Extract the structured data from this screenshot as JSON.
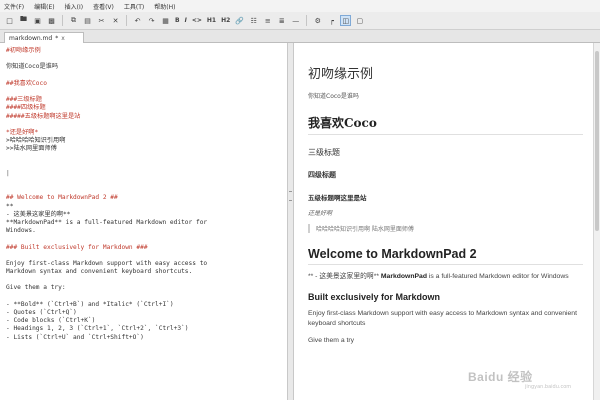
{
  "menu": [
    "文件(F)",
    "编辑(E)",
    "插入(I)",
    "查看(V)",
    "工具(T)",
    "帮助(H)"
  ],
  "toolbar": {
    "icons": [
      "new-file-icon",
      "open-folder-icon",
      "save-icon",
      "save-all-icon",
      "copy-icon",
      "paste-icon",
      "cut-icon",
      "delete-icon",
      "undo-icon",
      "redo-icon",
      "image-icon",
      "bold-text",
      "italic-text",
      "code-text",
      "h1-text",
      "h2-text",
      "hyperlink-icon",
      "date-icon",
      "unordered-list-icon",
      "ordered-list-icon",
      "horizontal-rule-icon",
      "settings-icon",
      "sidebar-icon",
      "live-preview-icon",
      "fullscreen-icon"
    ],
    "labels": {
      "bold": "B",
      "italic": "I",
      "code": "<>",
      "h1": "H1",
      "h2": "H2"
    }
  },
  "tab": {
    "label": "markdown.md",
    "modified": "*",
    "close": "x"
  },
  "editor": {
    "lines": [
      {
        "text": "#初吻缘示例",
        "style": "red"
      },
      {
        "text": "",
        "style": "dark"
      },
      {
        "text": "你知道Coco是谁吗",
        "style": "dark"
      },
      {
        "text": "",
        "style": "dark"
      },
      {
        "text": "##我喜欢Coco",
        "style": "red"
      },
      {
        "text": "",
        "style": "dark"
      },
      {
        "text": "###三级标题",
        "style": "red"
      },
      {
        "text": "####四级标题",
        "style": "red"
      },
      {
        "text": "#####五级标题啊这里是站",
        "style": "red"
      },
      {
        "text": "",
        "style": "dark"
      },
      {
        "text": "*还是好啊*",
        "style": "red"
      },
      {
        "text": ">哈哈哈哈知识引用啊",
        "style": "dark"
      },
      {
        "text": ">>陆水网里面师傅",
        "style": "dark"
      },
      {
        "text": "",
        "style": "dark"
      },
      {
        "text": "",
        "style": "dark"
      },
      {
        "text": "|",
        "style": "cursor"
      },
      {
        "text": "",
        "style": "dark"
      },
      {
        "text": "",
        "style": "dark"
      },
      {
        "text": "## Welcome to MarkdownPad 2 ##",
        "style": "red"
      },
      {
        "text": "**",
        "style": "dark"
      },
      {
        "text": "- 这美景这家里的啊**",
        "style": "dark"
      },
      {
        "text": "**MarkdownPad** is a full-featured Markdown editor for",
        "style": "dark"
      },
      {
        "text": "Windows.",
        "style": "dark"
      },
      {
        "text": "",
        "style": "dark"
      },
      {
        "text": "### Built exclusively for Markdown ###",
        "style": "red"
      },
      {
        "text": "",
        "style": "dark"
      },
      {
        "text": "Enjoy first-class Markdown support with easy access to",
        "style": "dark"
      },
      {
        "text": "Markdown syntax and convenient keyboard shortcuts.",
        "style": "dark"
      },
      {
        "text": "",
        "style": "dark"
      },
      {
        "text": "Give them a try:",
        "style": "dark"
      },
      {
        "text": "",
        "style": "dark"
      },
      {
        "text": "- **Bold** (`Ctrl+B`) and *Italic* (`Ctrl+I`)",
        "style": "dark"
      },
      {
        "text": "- Quotes (`Ctrl+Q`)",
        "style": "dark"
      },
      {
        "text": "- Code blocks (`Ctrl+K`)",
        "style": "dark"
      },
      {
        "text": "- Headings 1, 2, 3 (`Ctrl+1`, `Ctrl+2`, `Ctrl+3`)",
        "style": "dark"
      },
      {
        "text": "- Lists (`Ctrl+U` and `Ctrl+Shift+O`)",
        "style": "dark"
      }
    ]
  },
  "preview": {
    "h1": "初吻缘示例",
    "p1": "你知道Coco是谁吗",
    "h2": "我喜欢Coco",
    "h3": "三级标题",
    "h4": "四级标题",
    "h5": "五级标题啊这里是站",
    "italic": "还是好啊",
    "quote": "哈哈哈哈知识引用啊 陆水网里面师傅",
    "welcome": "Welcome to MarkdownPad 2",
    "intro_prefix": "** - 这美景这家里的啊** ",
    "intro_bold": "MarkdownPad",
    "intro_rest": " is a full-featured Markdown editor for Windows",
    "built": "Built exclusively for Markdown",
    "enjoy": "Enjoy first-class Markdown support with easy access to Markdown syntax and convenient keyboard shortcuts",
    "give": "Give them a try"
  },
  "watermark": {
    "main": "Baidu 经验",
    "sub": "jingyan.baidu.com"
  }
}
